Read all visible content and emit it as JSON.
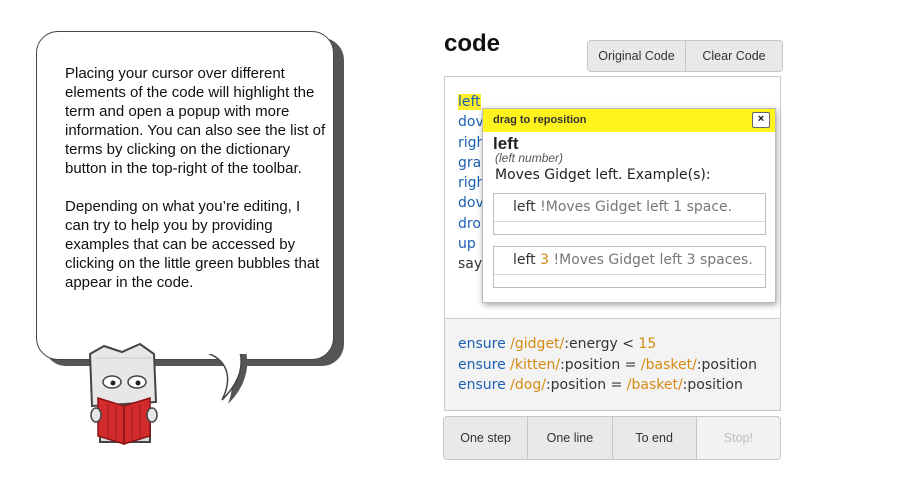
{
  "bubble": {
    "paragraph1": "Placing your cursor over different elements of the code will highlight the term and open a popup with more information. You can also see the list of terms by clicking on the dictionary button in the top-right of the toolbar.",
    "paragraph2": "Depending on what you’re editing, I can try to help you by providing examples that can be accessed by clicking on the little green bubbles that appear in the code."
  },
  "panel": {
    "title": "code",
    "original_code_label": "Original Code",
    "clear_code_label": "Clear Code"
  },
  "code_lines": [
    "left",
    "dov",
    "righ",
    "gra",
    "righ",
    "dov",
    "dro",
    "up",
    "say"
  ],
  "ensure_lines": [
    {
      "kw": "ensure",
      "obj": "/gidget/",
      "rest": ":energy < ",
      "num": "15",
      "obj2": "",
      "rest2": ""
    },
    {
      "kw": "ensure",
      "obj": "/kitten/",
      "rest": ":position = ",
      "num": "",
      "obj2": "/basket/",
      "rest2": ":position"
    },
    {
      "kw": "ensure",
      "obj": "/dog/",
      "rest": ":position = ",
      "num": "",
      "obj2": "/basket/",
      "rest2": ":position"
    }
  ],
  "run": {
    "one_step": "One step",
    "one_line": "One line",
    "to_end": "To end",
    "stop": "Stop!"
  },
  "popup": {
    "header": "drag to reposition",
    "close": "×",
    "term": "left",
    "signature": "(left number)",
    "sig_open": "(left ",
    "sig_arg": "number",
    "sig_close": ")",
    "description": "Moves Gidget left. Example(s):",
    "example1": {
      "code": "left",
      "comment": "!Moves Gidget left 1 space."
    },
    "example2": {
      "code": "left",
      "num": "3",
      "comment": "!Moves Gidget left 3 spaces."
    }
  },
  "colors": {
    "keyword": "#1a5fb4",
    "object": "#d58b12",
    "highlight": "#fff02a",
    "popup_header": "#fff31d",
    "mascot_book": "#d32b2b"
  },
  "icons": [
    "close-icon",
    "robot-mascot",
    "book-icon"
  ]
}
